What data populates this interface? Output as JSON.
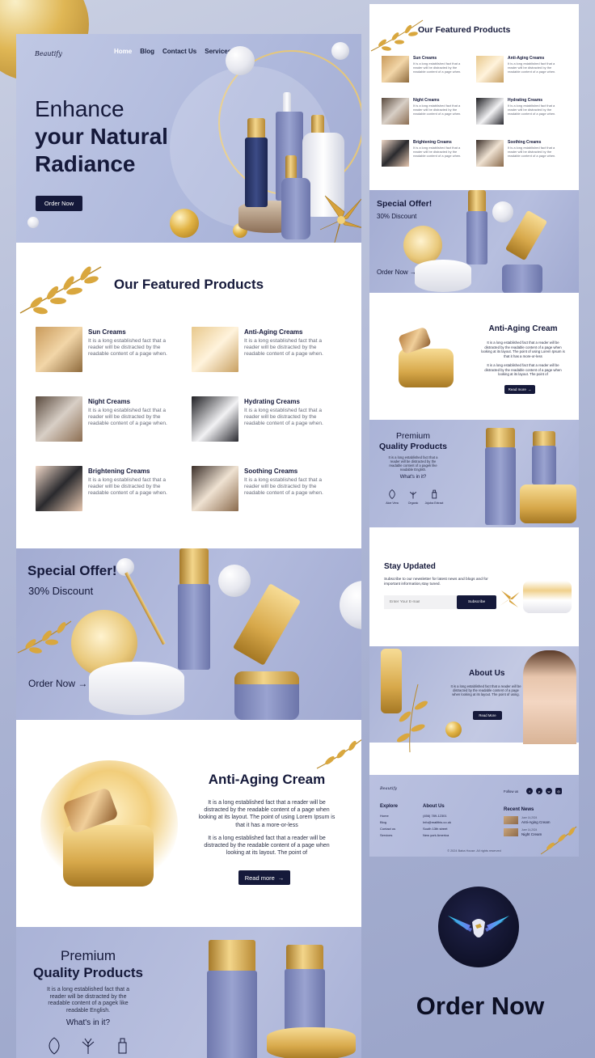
{
  "brand": "Beautify",
  "nav": [
    "Home",
    "Blog",
    "Contact Us",
    "Services"
  ],
  "hero": {
    "line1": "Enhance",
    "line2": "your Natural",
    "line3": "Radiance",
    "cta": "Order Now"
  },
  "featured": {
    "title": "Our Featured Products",
    "desc": "It is a long established fact that a reader will be distracted by the readable content of a page when.",
    "items": [
      {
        "name": "Sun Creams"
      },
      {
        "name": "Anti-Aging Creams"
      },
      {
        "name": "Night Creams"
      },
      {
        "name": "Hydrating Creams"
      },
      {
        "name": "Brightening Creams"
      },
      {
        "name": "Soothing Creams"
      }
    ]
  },
  "offer": {
    "title": "Special Offer!",
    "discount": "30% Discount",
    "cta": "Order Now →"
  },
  "aging": {
    "title": "Anti-Aging Cream",
    "p1": "It is a long established fact that a reader will be distracted by the readable content of a page when looking at its layout. The point of using Lorem Ipsum is that it has a more-or-less",
    "p2": "It is a long established fact that a reader will be distracted by the readable content of a page when looking at its layout. The point of",
    "cta": "Read more"
  },
  "premium": {
    "line1": "Premium",
    "line2": "Quality Products",
    "desc": "It is a long established fact that a reader will be distracted by the readable content of a pagek like readable English.",
    "what": "What's in it?",
    "features": [
      "Aloe Vera",
      "Organic",
      "Jojoba Extract"
    ]
  },
  "stay": {
    "title": "Stay Updated",
    "desc": "Subscribe to our newsletter for latest news and blogs and for important information,stay tuned.",
    "placeholder": "Enter Your E-mail",
    "button": "Subscribe"
  },
  "about": {
    "title": "About Us",
    "desc": "It is a long established fact that a reader will be distracted by the readable content of a page when looking at its layout. The point of using.",
    "cta": "Read More"
  },
  "footer": {
    "brand": "Beautify",
    "follow": "Follow us",
    "explore_title": "Explore",
    "explore": [
      "Home",
      "Blog",
      "Contact us",
      "Services"
    ],
    "about_title": "About Us",
    "about": [
      "(456) 789-12301",
      "Info@mailthis.co.uk",
      "South 13th street",
      "New york America"
    ],
    "news_title": "Recent News",
    "news": [
      {
        "date": "June 14,2024",
        "title": "Anti-Aging Cream"
      },
      {
        "date": "June 14,2024",
        "title": "Night Cream"
      }
    ],
    "copyright": "© 2024 Baba House. All rights reserved"
  },
  "cta_big": "Order Now",
  "colors": {
    "navy": "#15193a",
    "lavender": "#aab3d7",
    "gold": "#d7a84a"
  }
}
